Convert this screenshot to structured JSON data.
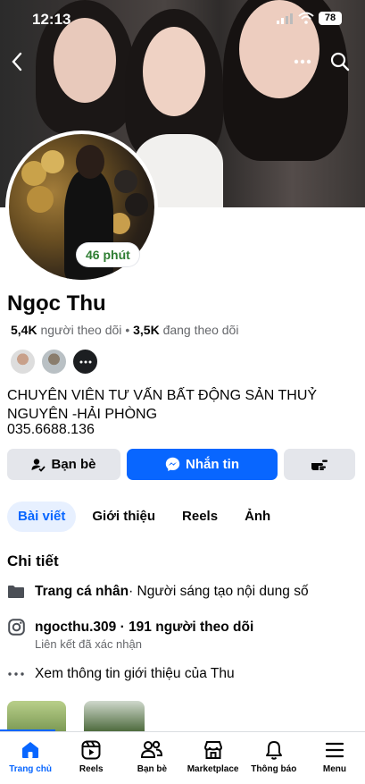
{
  "status_bar": {
    "time": "12:13",
    "battery": "78"
  },
  "profile": {
    "active_badge": "46 phút",
    "name": "Ngọc Thu",
    "followers_count": "5,4K",
    "followers_label": "người theo dõi",
    "following_count": "3,5K",
    "following_label": "đang theo dõi",
    "bio_line1": "CHUYÊN VIÊN TƯ VẤN BẤT ĐỘNG SẢN THUỶ",
    "bio_line2": "NGUYÊN -HẢI PHÒNG",
    "phone": "035.6688.136"
  },
  "actions": {
    "friends": "Bạn bè",
    "message": "Nhắn tin"
  },
  "tabs": [
    {
      "label": "Bài viết"
    },
    {
      "label": "Giới thiệu"
    },
    {
      "label": "Reels"
    },
    {
      "label": "Ảnh"
    }
  ],
  "details": {
    "title": "Chi tiết",
    "page_type_bold": "Trang cá nhân",
    "page_type_rest": " · Người sáng tạo nội dung số",
    "instagram_bold": "ngocthu.309 · 191 người theo dõi",
    "instagram_sub": "Liên kết đã xác nhận",
    "see_more": "Xem thông tin giới thiệu của Thu"
  },
  "nav": [
    {
      "label": "Trang chủ",
      "icon": "home-icon"
    },
    {
      "label": "Reels",
      "icon": "reels-icon"
    },
    {
      "label": "Bạn bè",
      "icon": "friends-icon"
    },
    {
      "label": "Marketplace",
      "icon": "marketplace-icon"
    },
    {
      "label": "Thông báo",
      "icon": "bell-icon"
    },
    {
      "label": "Menu",
      "icon": "menu-icon"
    }
  ],
  "colors": {
    "accent": "#0866ff",
    "active_green": "#2e7d32"
  }
}
